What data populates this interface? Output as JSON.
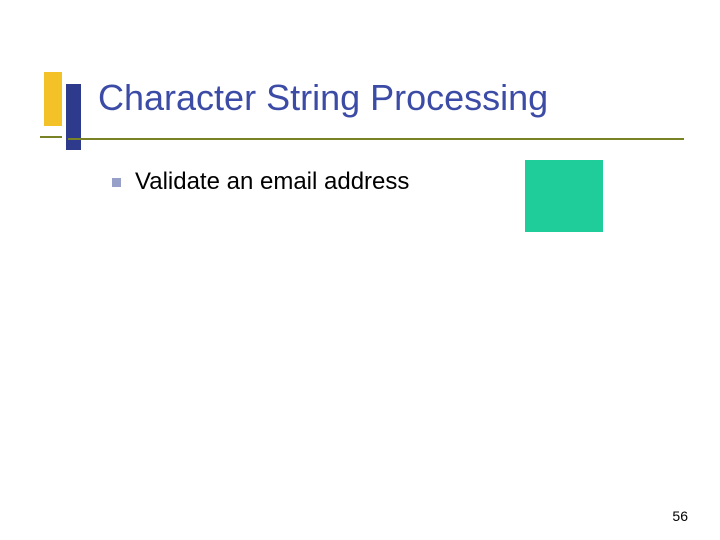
{
  "slide": {
    "title": "Character String Processing",
    "bullets": [
      {
        "text": "Validate an email address"
      }
    ],
    "page_number": "56"
  }
}
